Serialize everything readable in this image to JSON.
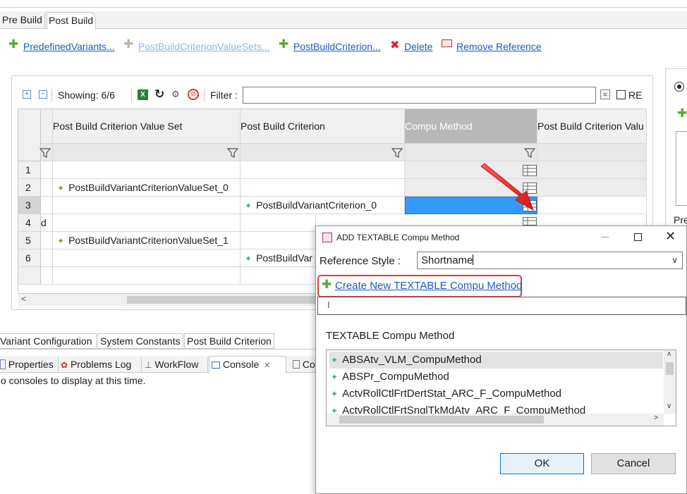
{
  "top_tabs": [
    "Pre Build",
    "Post Build"
  ],
  "toolbar": {
    "predefined_variants": "PredefinedVariants...",
    "criterion_value_sets": "PostBuildCriterionValueSets...",
    "post_build_criterion": "PostBuildCriterion...",
    "delete": "Delete",
    "remove_reference": "Remove Reference"
  },
  "table_toolbar": {
    "showing": "Showing: 6/6",
    "filter_label": "Filter :",
    "filter_value": "",
    "re_label": "RE"
  },
  "table": {
    "columns": [
      "Post Build Criterion Value Set",
      "Post Build Criterion",
      "Compu Method",
      "Post Build Criterion Valu"
    ],
    "rows": [
      {
        "num": "1",
        "prefix": "",
        "value_set": "",
        "criterion": ""
      },
      {
        "num": "2",
        "prefix": "",
        "value_set": "PostBuildVariantCriterionValueSet_0",
        "criterion": ""
      },
      {
        "num": "3",
        "prefix": "",
        "value_set": "",
        "criterion": "PostBuildVariantCriterion_0"
      },
      {
        "num": "4",
        "prefix": "d",
        "value_set": "",
        "criterion": ""
      },
      {
        "num": "5",
        "prefix": "",
        "value_set": "PostBuildVariantCriterionValueSet_1",
        "criterion": ""
      },
      {
        "num": "6",
        "prefix": "",
        "value_set": "",
        "criterion": "PostBuildVar"
      }
    ]
  },
  "bottom_tabs": [
    "Variant Configuration",
    "System Constants",
    "Post Build Criterion"
  ],
  "view_tabs": [
    "Properties",
    "Problems Log",
    "WorkFlow",
    "Console",
    "Co"
  ],
  "console_message": "o consoles to display at this time.",
  "right_panel": {
    "label": "Pre"
  },
  "dialog": {
    "title": "ADD TEXTABLE Compu Method",
    "reference_style_label": "Reference Style :",
    "reference_style_value": "Shortname",
    "create_link": "Create New TEXTABLE Compu Method",
    "search_value": "",
    "list_label": "TEXTABLE Compu Method",
    "items": [
      "ABSAtv_VLM_CompuMethod",
      "ABSPr_CompuMethod",
      "ActvRollCtlFrtDertStat_ARC_F_CompuMethod",
      "ActvRollCtlFrtSnglTkMdAtv_ARC_F_CompuMethod"
    ],
    "ok": "OK",
    "cancel": "Cancel"
  },
  "colors": {
    "link": "#1a5dbd",
    "selection": "#3399ff",
    "highlight_box": "#e03c3c",
    "arrow": "#e02a2a"
  }
}
